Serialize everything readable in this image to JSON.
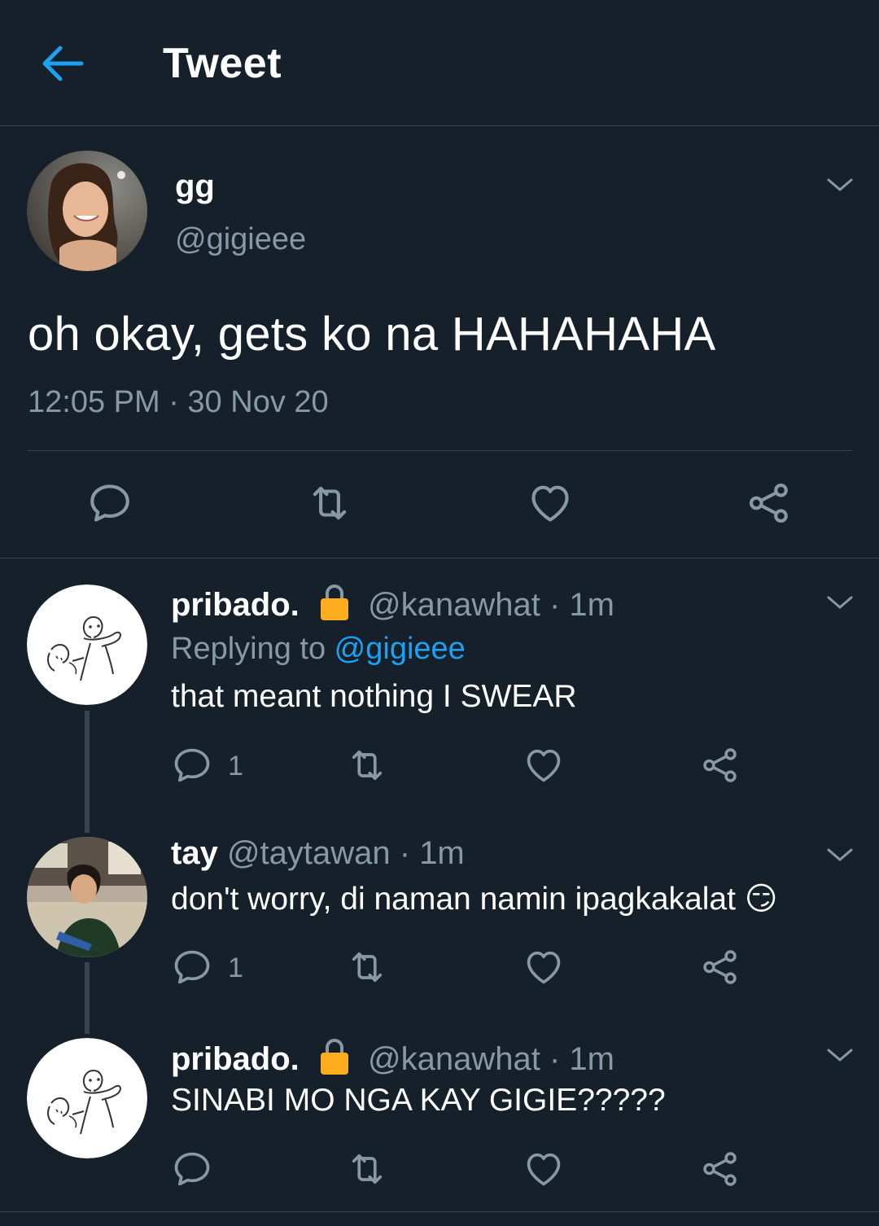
{
  "header": {
    "title": "Tweet"
  },
  "main_tweet": {
    "name": "gg",
    "handle": "@gigieee",
    "text": "oh okay, gets ko na HAHAHAHA",
    "timestamp": "12:05 PM · 30 Nov 20"
  },
  "replies": [
    {
      "name": "pribado.",
      "handle": "@kanawhat · 1m",
      "replying_prefix": "Replying to ",
      "replying_to": "@gigieee",
      "text": "that meant nothing I SWEAR",
      "reply_count": "1"
    },
    {
      "name": "tay",
      "handle": "@taytawan · 1m",
      "text": "don't worry, di naman namin ipagkakalat 😏",
      "reply_count": "1"
    },
    {
      "name": "pribado.",
      "handle": "@kanawhat · 1m",
      "text": "SINABI MO NGA KAY GIGIE?????"
    }
  ],
  "icons": [
    "back-arrow-icon",
    "chevron-down-icon",
    "reply-icon",
    "retweet-icon",
    "like-icon",
    "share-icon",
    "lock-icon"
  ],
  "colors": {
    "background": "#15202b",
    "accent": "#1da1f2",
    "secondary_text": "#8899a6",
    "divider": "#38444d",
    "lock": "#ffad1f"
  }
}
